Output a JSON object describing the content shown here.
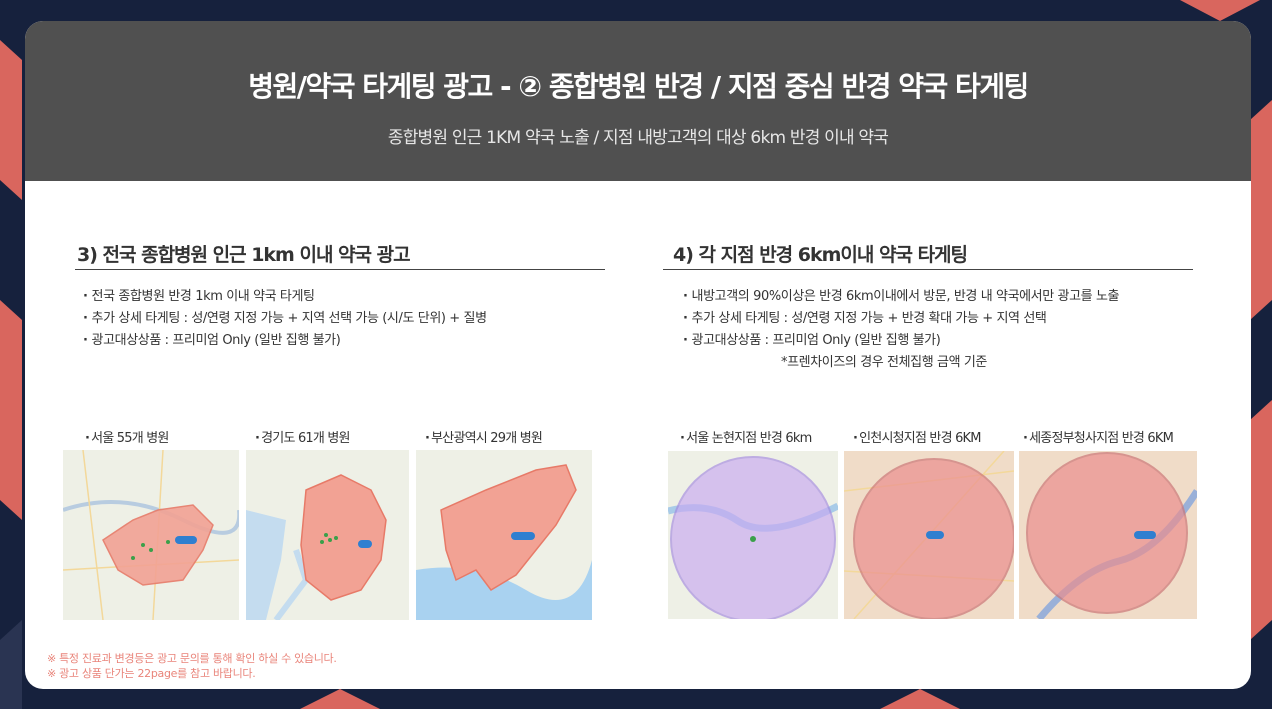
{
  "header": {
    "title": "병원/약국 타게팅 광고 - ② 종합병원 반경 / 지점 중심 반경 약국 타게팅",
    "subtitle": "종합병원 인근 1KM 약국 노출 / 지점 내방고객의 대상 6km 반경 이내 약국"
  },
  "section3": {
    "title": "3) 전국 종합병원 인근 1km 이내 약국 광고",
    "bullets": [
      "전국 종합병원 반경 1km 이내 약국 타게팅",
      "추가 상세 타게팅 : 성/연령 지정 가능 + 지역 선택 가능 (시/도 단위) + 질병",
      "광고대상상품 : 프리미엄 Only (일반 집행 불가)"
    ],
    "maps": [
      {
        "label": "서울 55개 병원"
      },
      {
        "label": "경기도 61개 병원"
      },
      {
        "label": "부산광역시 29개 병원"
      }
    ]
  },
  "section4": {
    "title": "4) 각 지점 반경 6km이내 약국 타게팅",
    "bullets": [
      "내방고객의 90%이상은 반경 6km이내에서 방문, 반경 내 약국에서만 광고를 노출",
      "추가 상세 타게팅 : 성/연령 지정 가능 + 반경 확대 가능 + 지역 선택",
      "광고대상상품 : 프리미엄 Only (일반 집행 불가)"
    ],
    "note": "*프렌차이즈의 경우 전체집행 금액 기준",
    "maps": [
      {
        "label": "서울 논현지점 반경 6km"
      },
      {
        "label": "인천시청지점 반경 6KM"
      },
      {
        "label": "세종정부청사지점 반경 6KM"
      }
    ]
  },
  "footer": {
    "note1": "※ 특정 진료과 변경등은 광고 문의를 통해 확인 하실 수 있습니다.",
    "note2": "※ 광고 상품 단가는 22page를 참고 바랍니다."
  },
  "colors": {
    "background": "#16213d",
    "accent": "#d9665e",
    "header": "#505050",
    "footer_text": "#e9847a"
  }
}
